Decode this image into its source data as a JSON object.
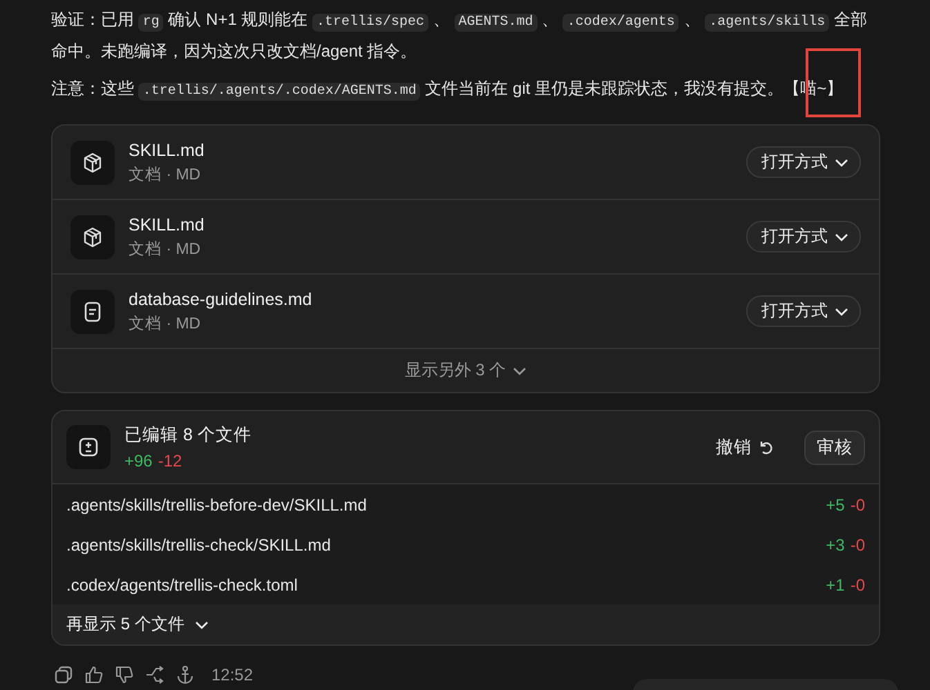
{
  "paragraphs": [
    {
      "segments": [
        {
          "kind": "text",
          "text": "验证：已用 "
        },
        {
          "kind": "code",
          "text": "rg"
        },
        {
          "kind": "text",
          "text": " 确认 N+1 规则能在 "
        },
        {
          "kind": "code",
          "text": ".trellis/spec"
        },
        {
          "kind": "text",
          "text": " 、 "
        },
        {
          "kind": "code",
          "text": "AGENTS.md"
        },
        {
          "kind": "text",
          "text": " 、 "
        },
        {
          "kind": "code",
          "text": ".codex/agents"
        },
        {
          "kind": "text",
          "text": " 、 "
        },
        {
          "kind": "code",
          "text": ".agents/skills"
        },
        {
          "kind": "text",
          "text": " 全部命中。未跑编译，因为这次只改文档/agent 指令。"
        }
      ]
    },
    {
      "segments": [
        {
          "kind": "text",
          "text": "注意：这些 "
        },
        {
          "kind": "code",
          "text": ".trellis/.agents/.codex/AGENTS.md"
        },
        {
          "kind": "text",
          "text": " 文件当前在 git 里仍是未跟踪状态，我没有提交。【喵~】"
        }
      ]
    }
  ],
  "attachments": {
    "files": [
      {
        "kind": "skill",
        "name": "SKILL.md",
        "meta": "文档 · MD",
        "open_with": "打开方式"
      },
      {
        "kind": "skill",
        "name": "SKILL.md",
        "meta": "文档 · MD",
        "open_with": "打开方式"
      },
      {
        "kind": "document",
        "name": "database-guidelines.md",
        "meta": "文档 · MD",
        "open_with": "打开方式"
      }
    ],
    "show_more": "显示另外 3 个"
  },
  "edits": {
    "title": "已编辑 8 个文件",
    "added": "+96",
    "removed": "-12",
    "undo": "撤销",
    "review": "审核",
    "files": [
      {
        "path": ".agents/skills/trellis-before-dev/SKILL.md",
        "added": "+5",
        "removed": "-0"
      },
      {
        "path": ".agents/skills/trellis-check/SKILL.md",
        "added": "+3",
        "removed": "-0"
      },
      {
        "path": ".codex/agents/trellis-check.toml",
        "added": "+1",
        "removed": "-0"
      }
    ],
    "show_more": "再显示 5 个文件"
  },
  "message_footer": {
    "time": "12:52"
  }
}
